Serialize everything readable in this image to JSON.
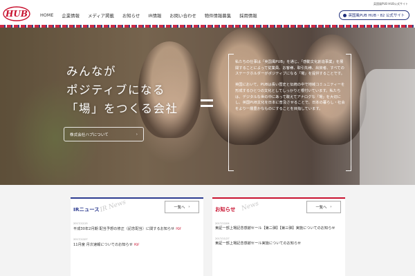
{
  "header": {
    "logo_text": "HUB",
    "corp_link": "英国風PUB HUB公式サイト",
    "nav": [
      "HOME",
      "企業情報",
      "メディア掲載",
      "お知らせ",
      "IR情報",
      "お問い合わせ",
      "物件情報募集",
      "採用情報"
    ],
    "pub_button": "英国風PUB HUB・82 公式サイト"
  },
  "hero": {
    "title_lines": [
      "みんなが",
      "ポジティブになる",
      "「場」をつくる会社"
    ],
    "about_button": "株式会社ハブについて",
    "about_arrow": "›",
    "paragraph1": "私たちの仕事は「英国風PUB」を通じ、「感動文化創造事業」を展開することによって従業員、お客様、取引先様、出資者、すべてのステークホルダーがポジティブになる「場」を提供することです。",
    "paragraph2": "英国において、PUBは長い歴史と伝統の中で地域コミュニティーを形成するひとつの文化としてしっかりと根付いています。私たちは、デジタルな世の中にあって敢えてアナログな「場」を大切にし、英国PUB文化を日本に普及させることで、日本の暮らし・社会をより一層豊かなものにすることを目指しています。"
  },
  "news": {
    "ir": {
      "title": "IRニュース",
      "sub": "IR News",
      "more": "一覧へ",
      "arrow": "›",
      "items": [
        {
          "date": "2017/12/15",
          "title": "平成30年2月期 配当予想の修正（記念配当）に関するお知らせ",
          "badge": "PDF"
        },
        {
          "date": "2017/12/07",
          "title": "11月度 月次速報についてのお知らせ",
          "badge": "PDF"
        }
      ]
    },
    "info": {
      "title": "お知らせ",
      "sub": "News",
      "more": "一覧へ",
      "arrow": "›",
      "items": [
        {
          "date": "2017/12/04",
          "title": "東証一部上場記念感謝セール【第二弾】【第三弾】実施についてのお知らせ",
          "badge": ""
        },
        {
          "date": "2017/11/27",
          "title": "東証一部上場記念感謝セール実施についてのお知らせ",
          "badge": ""
        }
      ]
    }
  },
  "colors": {
    "brand_red": "#c8102e",
    "brand_navy": "#1f2e7a"
  }
}
